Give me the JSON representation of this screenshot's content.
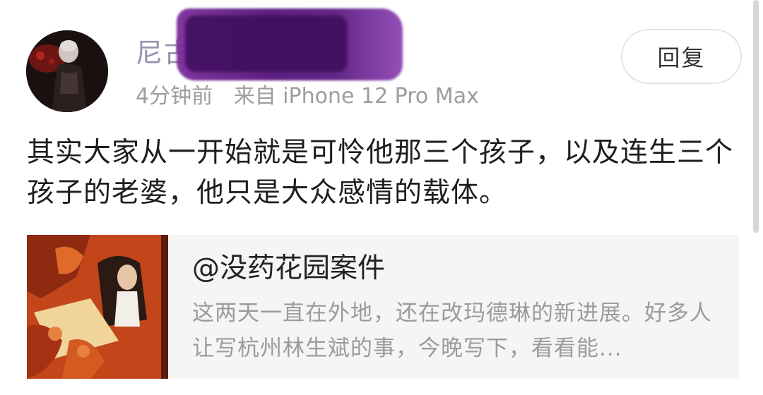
{
  "comment": {
    "username": "尼古",
    "time": "4分钟前",
    "source": "来自 iPhone 12 Pro Max",
    "reply_label": "回复",
    "text": "其实大家从一开始就是可怜他那三个孩子，以及连生三个孩子的老婆，他只是大众感情的载体。"
  },
  "quote_card": {
    "title": "@没药花园案件",
    "excerpt": "这两天一直在外地，还在改玛德琳的新进展。好多人让写杭州林生斌的事，今晚写下，看看能..."
  },
  "colors": {
    "redaction": "#5a1b80",
    "username": "#9a8fb0",
    "meta_text": "#9d9d9d",
    "card_bg": "#f5f5f5"
  },
  "icons": {
    "avatar": "user-avatar-photo",
    "thumbnail": "article-thumbnail-painting"
  }
}
